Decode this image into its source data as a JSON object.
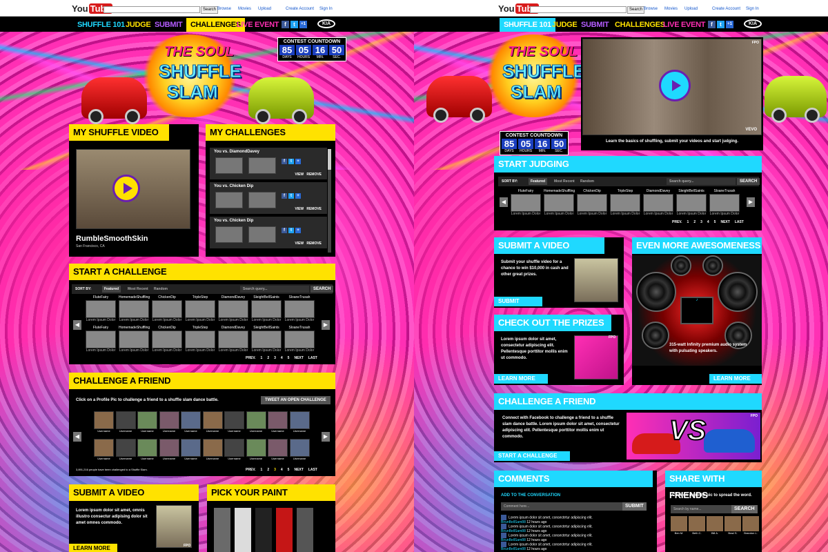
{
  "youtube": {
    "logo_you": "You",
    "logo_tube": "Tube",
    "search_button": "Search",
    "links": [
      "Browse",
      "Movies",
      "Upload"
    ],
    "account": [
      "Create Account",
      "Sign In"
    ]
  },
  "nav": {
    "items": [
      "SHUFFLE 101",
      "JUDGE",
      "SUBMIT",
      "CHALLENGES",
      "LIVE EVENT"
    ],
    "social": [
      "f",
      "t",
      "+1"
    ],
    "kia": "KIA"
  },
  "logo": {
    "line1": "THE SOUL",
    "line2": "SHUFFLE",
    "line3": "SLAM"
  },
  "countdown": {
    "title": "CONTEST COUNTDOWN",
    "values": [
      "85",
      "05",
      "16",
      "50"
    ],
    "labels": [
      "DAYS",
      "HOURS",
      "MIN.",
      "SEC."
    ]
  },
  "left": {
    "my_video": {
      "title": "MY SHUFFLE VIDEO",
      "name": "RumbleSmoothSkin",
      "location": "San Francisco, CA"
    },
    "my_challenges": {
      "title": "MY CHALLENGES",
      "rows": [
        {
          "label": "You vs. DiamondDavey",
          "view": "VIEW",
          "remove": "REMOVE"
        },
        {
          "label": "You vs. Chicken Dip",
          "view": "VIEW",
          "remove": "REMOVE"
        },
        {
          "label": "You vs. Chicken Dip",
          "view": "VIEW",
          "remove": "REMOVE"
        }
      ]
    },
    "start_challenge": {
      "title": "START A CHALLENGE",
      "sort_by": "SORT BY:",
      "tabs": [
        "Featured",
        "Most Recent",
        "Random"
      ],
      "search_placeholder": "Search query...",
      "search_button": "SEARCH",
      "users": [
        "FluteFairy",
        "HomemadeShuffling",
        "ChickenDip",
        "TripleStep",
        "DiamondDavey",
        "SleightBellSaints",
        "SloaneTrusah"
      ],
      "desc": "Lorem Ipsum Dolor",
      "pager": [
        "PREV.",
        "1",
        "2",
        "3",
        "4",
        "5",
        "NEXT",
        "LAST"
      ]
    },
    "challenge_friend": {
      "title": "CHALLENGE A FRIEND",
      "intro": "Click on a Profile Pic to challenge a friend to a shuffle slam dance battle.",
      "tweet": "TWEET AN OPEN CHALLENGE",
      "username": "Username",
      "stat": "3,891,216 people have been challenged to a Shuffle Slam.",
      "pager": [
        "PREV.",
        "1",
        "2",
        "3",
        "4",
        "5",
        "NEXT",
        "LAST"
      ]
    },
    "submit_video": {
      "title": "SUBMIT A VIDEO",
      "text": "Lorem ipsum dolor sit amet, omnis illustro consectur adipising dolor sit amet omnes commodo.",
      "button": "LEARN MORE",
      "fpo": "FPO"
    },
    "pick_paint": {
      "title": "PICK YOUR PAINT"
    }
  },
  "right": {
    "hero": {
      "caption": "Learn the basics of shuffling, submit your videos and start judging.",
      "fpo": "FPO",
      "vevo": "VEVO"
    },
    "start_judging": {
      "title": "START JUDGING",
      "sort_by": "SORT BY:",
      "tabs": [
        "Featured",
        "Most Recent",
        "Random"
      ],
      "search_placeholder": "Search query...",
      "search_button": "SEARCH",
      "users": [
        "FluteFairy",
        "HomemadeShuffling",
        "ChickenDip",
        "TripleStep",
        "DiamondDavey",
        "SleightBellSaints",
        "SloaneTrusah"
      ],
      "desc": "Lorem Ipsum Dolor",
      "pager": [
        "PREV.",
        "1",
        "2",
        "3",
        "4",
        "5",
        "NEXT",
        "LAST"
      ]
    },
    "submit_video": {
      "title": "SUBMIT A VIDEO",
      "text": "Submit your shuffle video for a chance to win $10,000 in cash and other great prizes.",
      "button": "SUBMIT"
    },
    "awesome": {
      "title": "EVEN MORE AWESOMENESS",
      "caption": "315-watt Infinity premium audio system with pulsating speakers.",
      "button": "LEARN MORE"
    },
    "prizes": {
      "title": "CHECK OUT THE PRIZES",
      "text": "Lorem ipsum dolor sit amet, consectetur adipiscing elit. Pellentesque porttitor mollis enim ut commodo.",
      "button": "LEARN MORE",
      "fpo": "FPO"
    },
    "challenge_friend": {
      "title": "CHALLENGE A FRIEND",
      "text": "Connect with Facebook to challenge a friend to a shuffle slam dance battle. Lorem ipsum dolor sit amet, consectetur adipiscing elit. Pellentesque porttitor mollis enim ut commodo.",
      "vs": "VS",
      "button": "START A CHALLENGE",
      "fpo": "FPO"
    },
    "comments": {
      "title": "COMMENTS",
      "add": "ADD TO THE CONVERSATION",
      "placeholder": "Comment here...",
      "submit": "SUBMIT",
      "items": [
        {
          "text": "Lorem ipsum dolor sit amet, consectetur adipiscing elit.",
          "user": "BirunBellSam88",
          "time": "12 hours ago"
        },
        {
          "text": "Lorem ipsum dolor sit amet, consectetur adipiscing elit.",
          "user": "BirunBellSam88",
          "time": "12 hours ago"
        },
        {
          "text": "Lorem ipsum dolor sit amet, consectetur adipiscing elit.",
          "user": "BirunBellSam88",
          "time": "12 hours ago"
        },
        {
          "text": "Lorem ipsum dolor sit amet, consectetur adipiscing elit.",
          "user": "BirunBellSam88",
          "time": "12 hours ago"
        }
      ]
    },
    "share": {
      "title": "SHARE WITH FRIENDS",
      "intro": "Click on a profile pic to spread the word.",
      "placeholder": "Search by name...",
      "button": "SEARCH",
      "friends": [
        "Ben M.",
        "Beth C.",
        "Bill A.",
        "Brad S.",
        "Brandon L."
      ]
    }
  }
}
